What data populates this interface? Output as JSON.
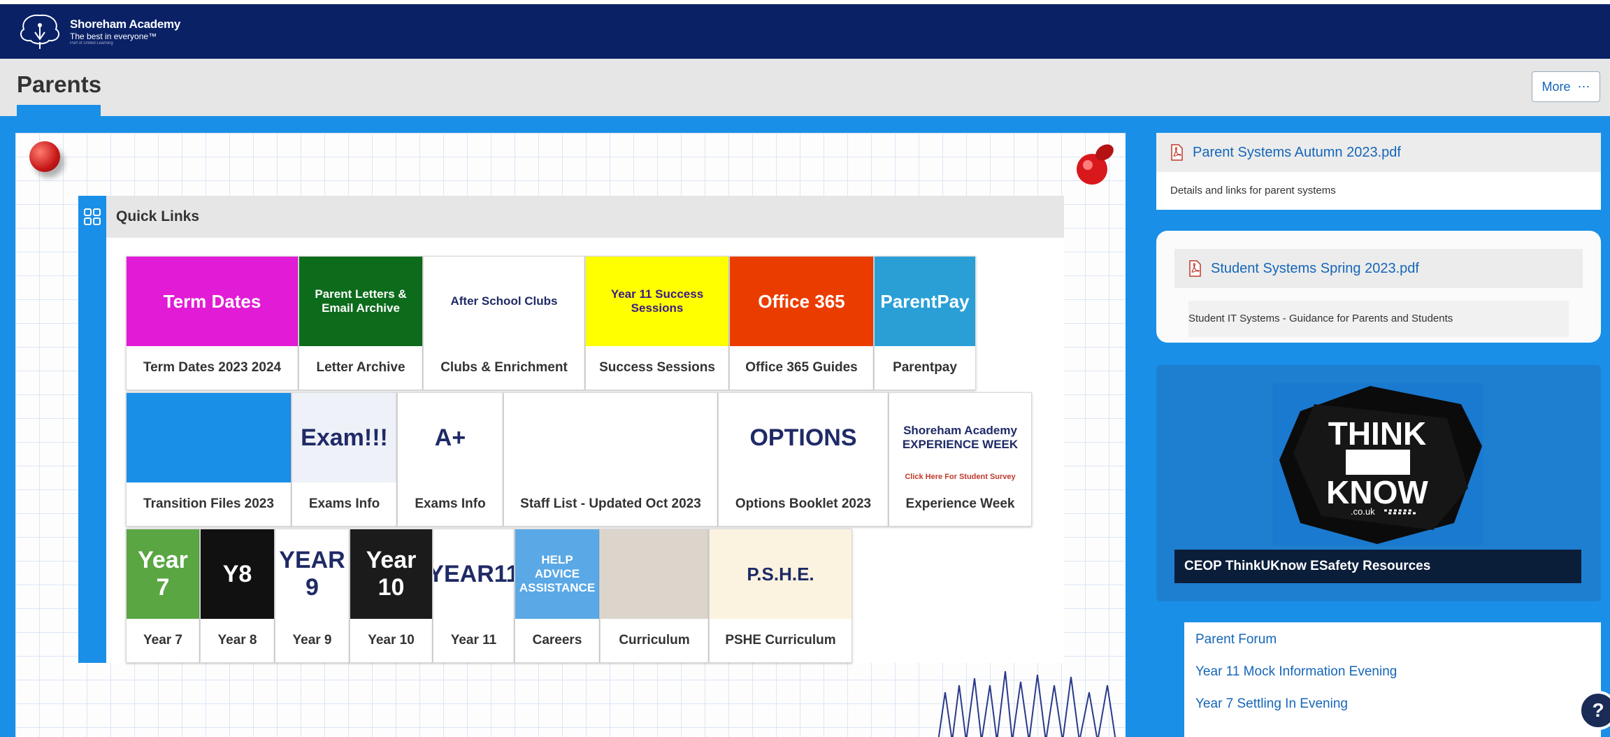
{
  "header": {
    "school_name": "Shoreham Academy",
    "tagline": "The best in everyone™",
    "tagline_small": "Part of United Learning"
  },
  "page": {
    "title": "Parents",
    "more_label": "More"
  },
  "quick_links": {
    "title": "Quick Links",
    "tiles": [
      {
        "label": "Term Dates 2023 2024",
        "image_text": "Term Dates",
        "bg": "#e21bd6"
      },
      {
        "label": "Letter Archive",
        "image_text": "Parent Letters & Email Archive",
        "bg": "#0d6b1c"
      },
      {
        "label": "Clubs & Enrichment",
        "image_text": "After School Clubs",
        "bg": "#ffffff"
      },
      {
        "label": "Success Sessions",
        "image_text": "Year 11 Success Sessions",
        "bg": "#ffff00"
      },
      {
        "label": "Office 365 Guides",
        "image_text": "Office 365",
        "bg": "#eb3c00"
      },
      {
        "label": "Parentpay",
        "image_text": "ParentPay",
        "bg": "#2a9fd6"
      },
      {
        "label": "Transition Files 2023",
        "image_text": "",
        "bg": "#1a8fe8"
      },
      {
        "label": "Exams Info",
        "image_text": "Exam!!!",
        "bg": "#eef1f7"
      },
      {
        "label": "Exams Info",
        "image_text": "A+",
        "bg": "#ffffff"
      },
      {
        "label": "Staff List - Updated Oct 2023",
        "image_text": "",
        "bg": "#ffffff"
      },
      {
        "label": "Options Booklet 2023",
        "image_text": "OPTIONS",
        "bg": "#ffffff"
      },
      {
        "label": "Experience Week",
        "image_text": "Shoreham Academy EXPERIENCE WEEK",
        "image_subtext": "Click Here For Student Survey",
        "bg": "#ffffff"
      },
      {
        "label": "Year 7",
        "image_text": "Year 7",
        "bg": "#5aa642"
      },
      {
        "label": "Year 8",
        "image_text": "Y8",
        "bg": "#111111"
      },
      {
        "label": "Year 9",
        "image_text": "YEAR 9",
        "bg": "#ffffff"
      },
      {
        "label": "Year 10",
        "image_text": "Year 10",
        "bg": "#1b1b1b"
      },
      {
        "label": "Year 11",
        "image_text": "YEAR11",
        "bg": "#ffffff"
      },
      {
        "label": "Careers",
        "image_text": "HELP ADVICE ASSISTANCE",
        "bg": "#5aa8e6"
      },
      {
        "label": "Curriculum",
        "image_text": "",
        "bg": "#dcd5cc"
      },
      {
        "label": "PSHE Curriculum",
        "image_text": "P.S.H.E.",
        "bg": "#fbf3df"
      }
    ]
  },
  "documents": [
    {
      "link": "Parent Systems Autumn 2023.pdf",
      "desc": "Details and links for parent systems"
    },
    {
      "link": "Student Systems Spring 2023.pdf",
      "desc": "Student IT Systems - Guidance for Parents and Students"
    }
  ],
  "thinkuknow": {
    "line1": "THINK",
    "line2": "U",
    "line3": "KNOW",
    "domain": ".co.uk",
    "caption": "CEOP ThinkUKnow ESafety Resources"
  },
  "events": [
    {
      "label": "Parent Forum"
    },
    {
      "label": "Year 11 Mock Information Evening"
    },
    {
      "label": "Year 7 Settling In Evening"
    }
  ],
  "help": {
    "symbol": "?"
  },
  "colors": {
    "navy": "#0a2166",
    "blue": "#1a8fe8",
    "link": "#1566b8"
  }
}
